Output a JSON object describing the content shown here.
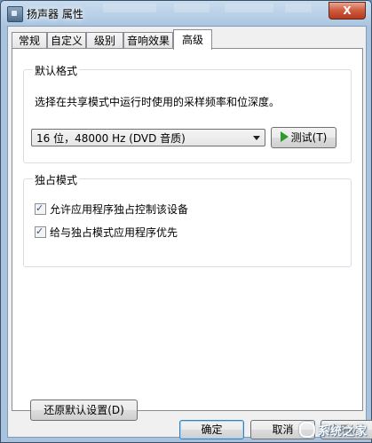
{
  "window": {
    "title": "扬声器 属性",
    "close_label": "X"
  },
  "tabs": [
    {
      "label": "常规"
    },
    {
      "label": "自定义"
    },
    {
      "label": "级别"
    },
    {
      "label": "音响效果"
    },
    {
      "label": "高级"
    }
  ],
  "default_format": {
    "group_title": "默认格式",
    "description": "选择在共享模式中运行时使用的采样频率和位深度。",
    "selected_value": "16 位，48000 Hz (DVD 音质)",
    "test_button": "测试(T)"
  },
  "exclusive_mode": {
    "group_title": "独占模式",
    "options": [
      {
        "label": "允许应用程序独占控制该设备",
        "checked": true
      },
      {
        "label": "给与独占模式应用程序优先",
        "checked": true
      }
    ]
  },
  "restore_button": "还原默认设置(D)",
  "footer": {
    "ok": "确定",
    "cancel": "取消",
    "apply": "应用(A)"
  },
  "watermark": "系统之家"
}
